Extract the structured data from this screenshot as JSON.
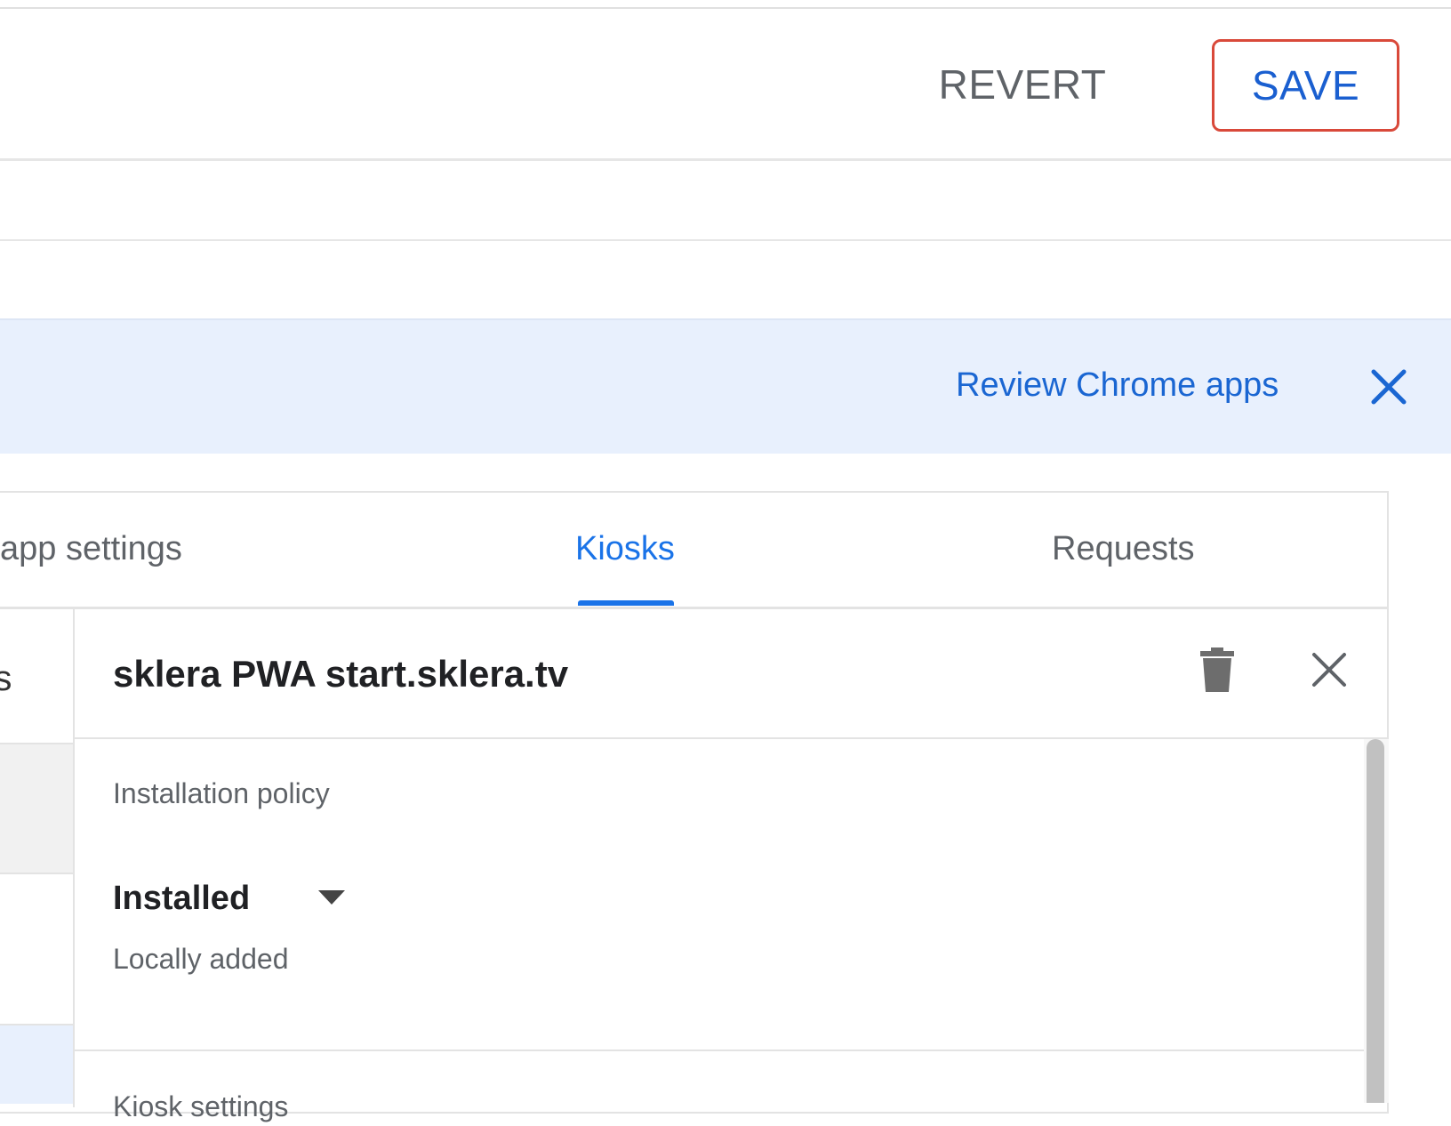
{
  "toolbar": {
    "revert_label": "REVERT",
    "save_label": "SAVE"
  },
  "banner": {
    "link_label": "Review Chrome apps",
    "close_icon": "close-icon"
  },
  "tabs": [
    {
      "label": "app settings",
      "active": false
    },
    {
      "label": "Kiosks",
      "active": true
    },
    {
      "label": "Requests",
      "active": false
    }
  ],
  "left_list": {
    "cutoff_text": "rs"
  },
  "detail": {
    "title": "sklera PWA start.sklera.tv",
    "delete_icon": "trash-icon",
    "close_icon": "close-icon",
    "installation_policy": {
      "label": "Installation policy",
      "value": "Installed",
      "helper": "Locally added"
    },
    "next_section_label": "Kiosk settings"
  },
  "colors": {
    "accent": "#1a73e8",
    "save_outline": "#d9493a",
    "banner_bg": "#e8f0fd"
  }
}
